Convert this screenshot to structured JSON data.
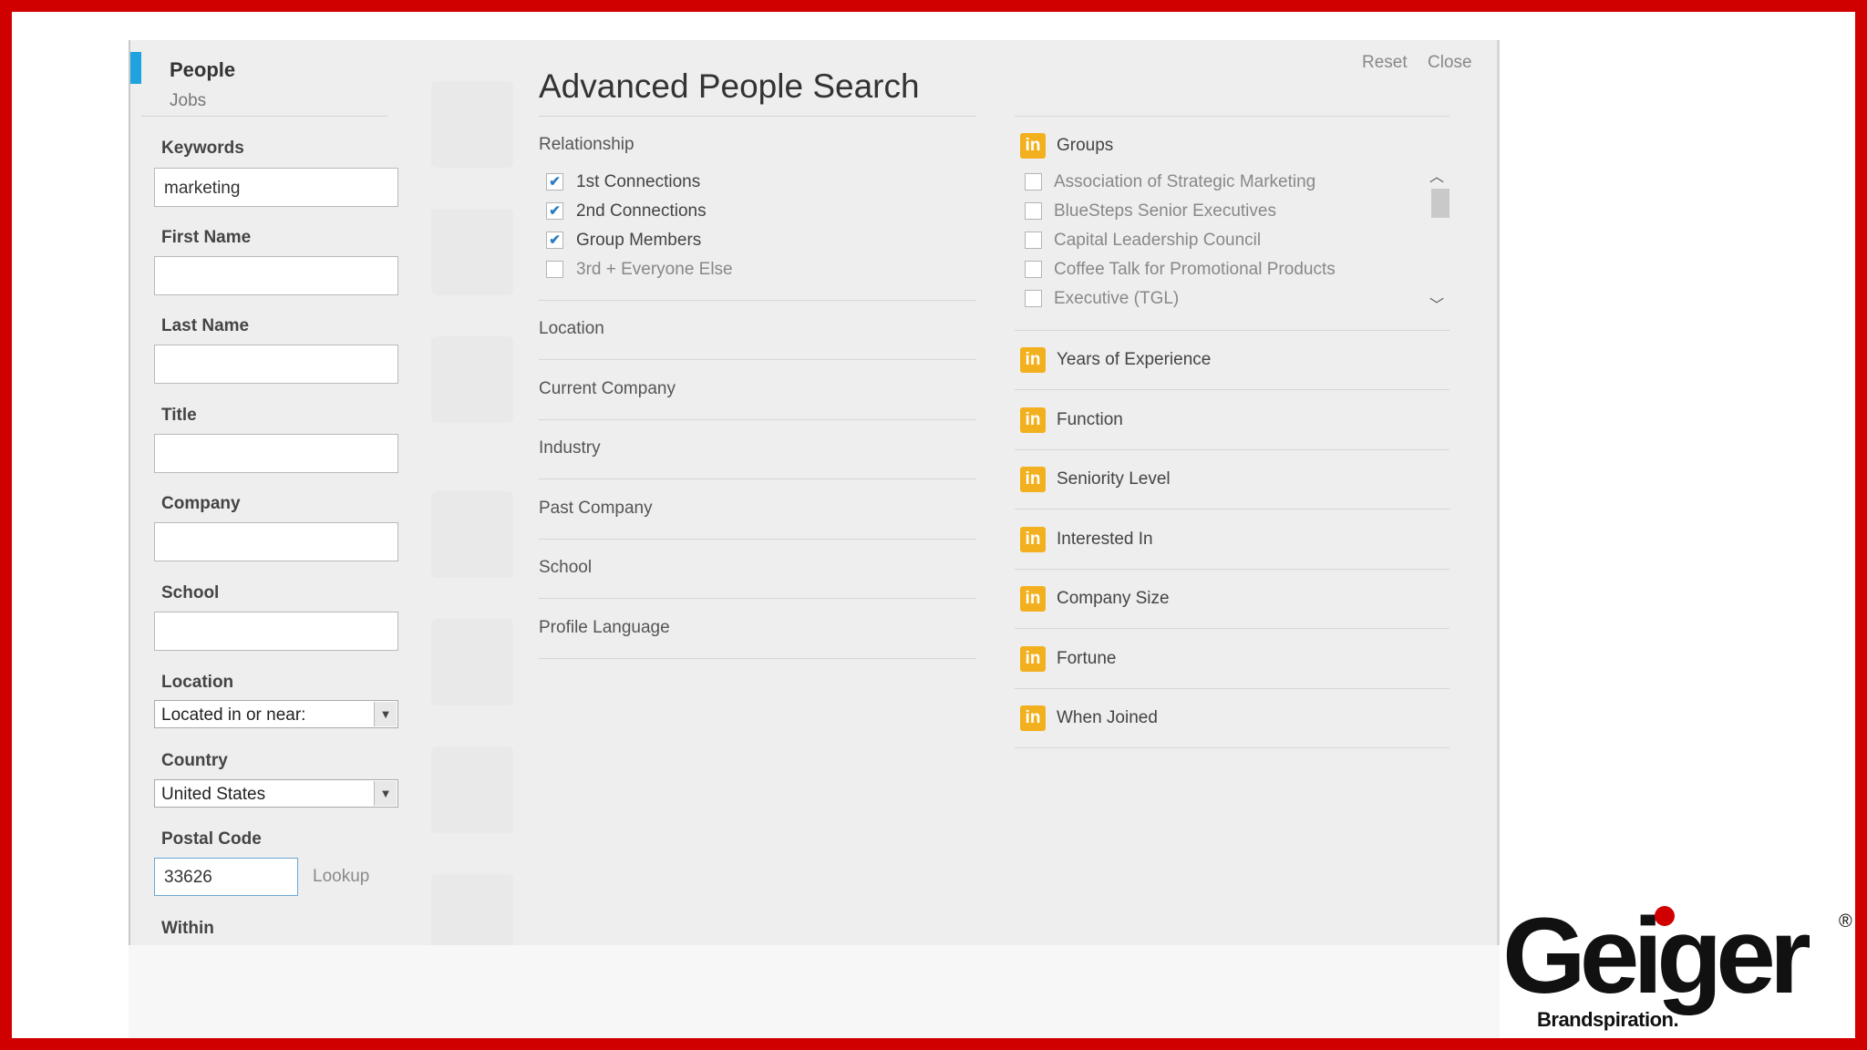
{
  "brand_color": "#d10000",
  "accent_color": "#1fa3e0",
  "badge_color": "#f2b01e",
  "nav": {
    "people": "People",
    "jobs": "Jobs"
  },
  "form": {
    "keywords_label": "Keywords",
    "keywords_value": "marketing",
    "first_name_label": "First Name",
    "last_name_label": "Last Name",
    "title_label": "Title",
    "company_label": "Company",
    "school_label": "School",
    "location_label": "Location",
    "location_value": "Located in or near:",
    "country_label": "Country",
    "country_value": "United States",
    "postal_label": "Postal Code",
    "postal_value": "33626",
    "lookup": "Lookup",
    "within_label": "Within"
  },
  "search": {
    "title": "Advanced People Search",
    "reset": "Reset",
    "close": "Close",
    "relationship_label": "Relationship",
    "relationship": [
      {
        "label": "1st Connections",
        "checked": true
      },
      {
        "label": "2nd Connections",
        "checked": true
      },
      {
        "label": "Group Members",
        "checked": true
      },
      {
        "label": "3rd + Everyone Else",
        "checked": false
      }
    ],
    "sections": [
      "Location",
      "Current Company",
      "Industry",
      "Past Company",
      "School",
      "Profile Language"
    ]
  },
  "premium": {
    "badge": "in",
    "groups_label": "Groups",
    "groups": [
      "Association of Strategic Marketing",
      "BlueSteps Senior Executives",
      "Capital Leadership Council",
      "Coffee Talk for Promotional Products",
      "Executive (TGL)"
    ],
    "filters": [
      "Years of Experience",
      "Function",
      "Seniority Level",
      "Interested In",
      "Company Size",
      "Fortune",
      "When Joined"
    ]
  },
  "logo": {
    "name": "Geiger",
    "tagline": "Brandspiration.",
    "reg": "®"
  }
}
